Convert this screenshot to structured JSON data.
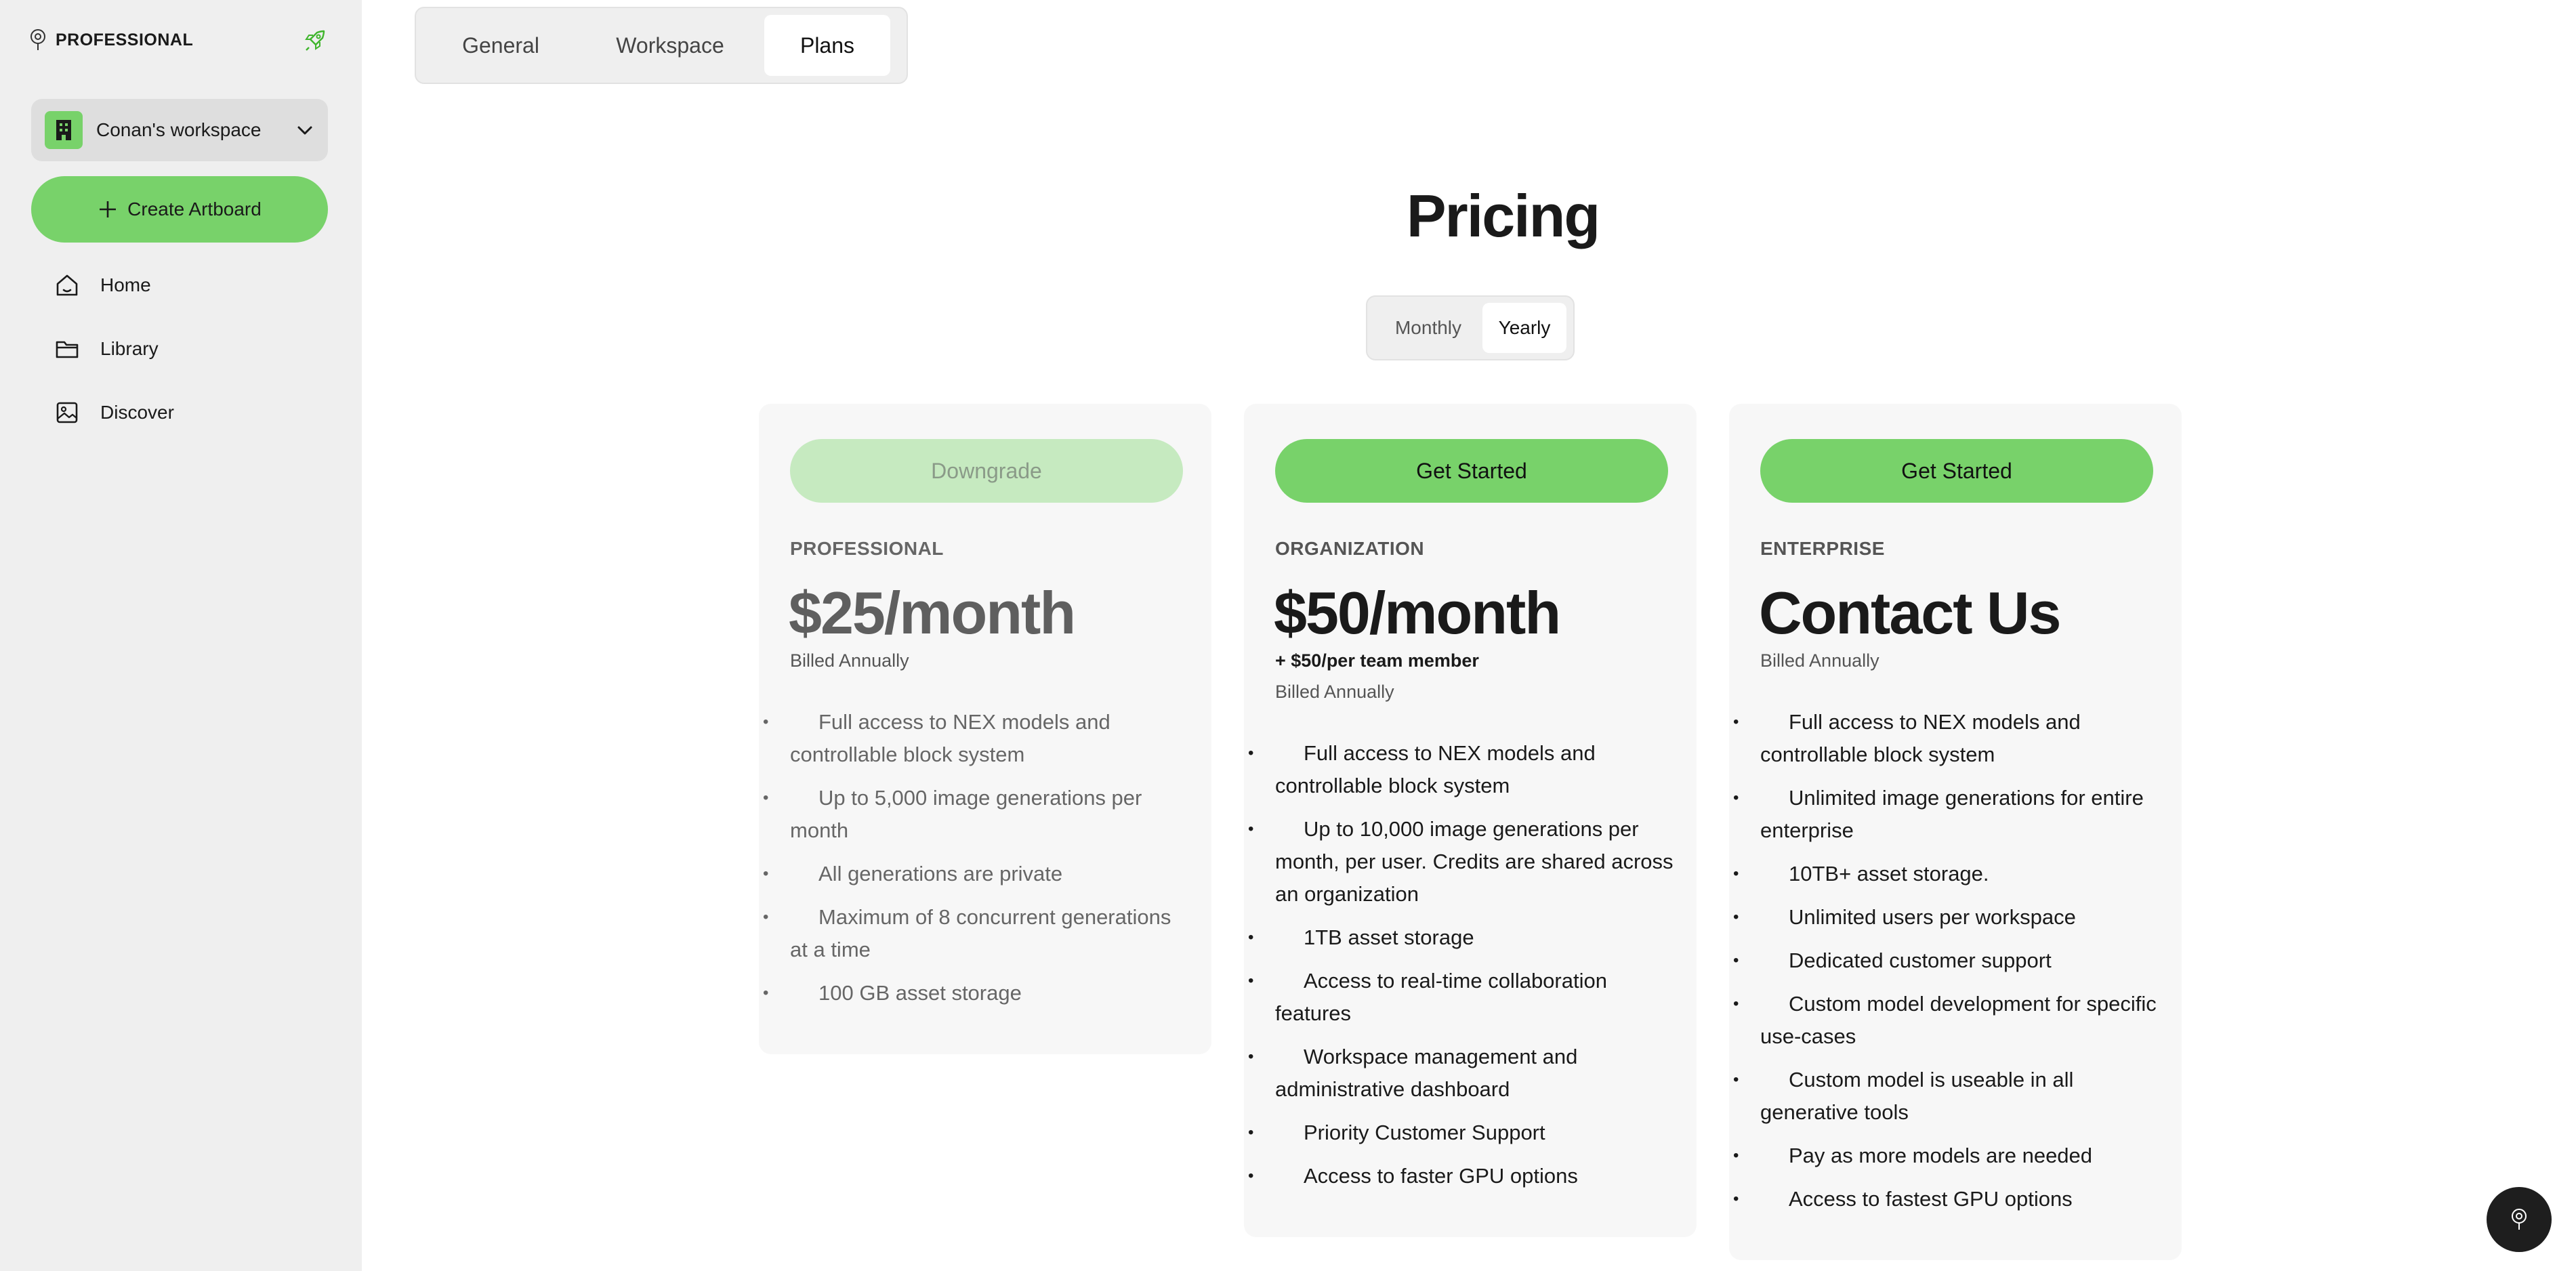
{
  "sidebar": {
    "brand": "PROFESSIONAL",
    "workspace_name": "Conan's workspace",
    "create_label": "Create Artboard",
    "items": [
      {
        "label": "Home",
        "icon": "home-icon"
      },
      {
        "label": "Library",
        "icon": "folder-icon"
      },
      {
        "label": "Discover",
        "icon": "image-icon"
      }
    ]
  },
  "tabs": [
    "General",
    "Workspace",
    "Plans"
  ],
  "active_tab": "Plans",
  "pricing": {
    "title": "Pricing",
    "toggle": [
      "Monthly",
      "Yearly"
    ],
    "toggle_selected": "Yearly"
  },
  "plans": [
    {
      "button": "Downgrade",
      "tier": "PROFESSIONAL",
      "price": "$25/month",
      "billing": "Billed Annually",
      "features": [
        "Full access to NEX models and controllable block system",
        "Up to 5,000 image generations per month",
        "All generations are private",
        "Maximum of 8 concurrent generations at a time",
        "100 GB asset storage"
      ]
    },
    {
      "button": "Get Started",
      "tier": "ORGANIZATION",
      "price": "$50/month",
      "extra": "+ $50/per team member",
      "billing": "Billed Annually",
      "features": [
        "Full access to NEX models and controllable block system",
        "Up to 10,000 image generations per month, per user. Credits are shared across an organization",
        "1TB asset storage",
        "Access to real-time collaboration features",
        "Workspace management and administrative dashboard",
        "Priority Customer Support",
        "Access to faster GPU options"
      ]
    },
    {
      "button": "Get Started",
      "tier": "ENTERPRISE",
      "price": "Contact Us",
      "billing": "Billed Annually",
      "features": [
        "Full access to NEX models and controllable block system",
        "Unlimited image generations for entire enterprise",
        "10TB+ asset storage.",
        "Unlimited users per workspace",
        "Dedicated customer support",
        "Custom model development for specific use-cases",
        "Custom model is useable in all generative tools",
        "Pay as more models are needed",
        "Access to fastest GPU options"
      ]
    }
  ],
  "colors": {
    "accent": "#78d26a",
    "accent_faded": "#c6eac0",
    "sidebar_bg": "#efefef",
    "card_bg": "#f7f7f7"
  }
}
